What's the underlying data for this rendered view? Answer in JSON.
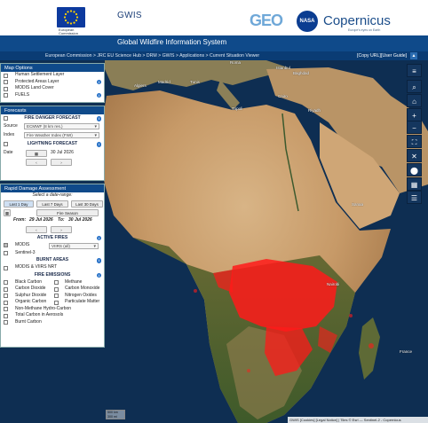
{
  "header": {
    "eu_org_line1": "European",
    "eu_org_line2": "Commission",
    "app_short": "GWIS",
    "geo_logo": "GEO",
    "nasa_logo": "NASA",
    "copernicus_logo": "Copernicus",
    "copernicus_tagline": "Europe's eyes on Earth",
    "site_title": "Global Wildfire Information System"
  },
  "breadcrumb": {
    "path": "European Commission > JRC EU Science Hub > DRM > GWIS > Applications > Current Situation Viewer",
    "copy_url": "[Copy URL]",
    "user_guide": "[User Guide]"
  },
  "map_options": {
    "title": "Map Options",
    "items": [
      {
        "label": "Human Settlement Layer",
        "info": false
      },
      {
        "label": "Protected Areas Layer",
        "info": true
      },
      {
        "label": "MODIS Land Cover",
        "info": false
      },
      {
        "label": "FUELS",
        "info": true
      }
    ]
  },
  "forecasts": {
    "title": "Forecasts",
    "fire_danger_title": "FIRE DANGER FORECAST",
    "source_label": "Source",
    "source_value": "ECMWF (8 km res.)",
    "index_label": "Index",
    "index_value": "Fire Weather Index (FWI)",
    "lightning_title": "LIGHTNING FORECAST",
    "date_label": "Date",
    "date_value": "30 Jul 2026",
    "prev_arrow": "‹",
    "next_arrow": "›"
  },
  "rapid_damage": {
    "title": "Rapid Damage Assessment",
    "select_range": "Select a date-range:",
    "btn_last1": "Last 1 Day",
    "btn_last7": "Last 7 Days",
    "btn_last30": "Last 30 Days",
    "btn_fire_season": "Fire Season",
    "from_label": "From:",
    "from_date": "29 Jul 2026",
    "to_label": "To:",
    "to_date": "30 Jul 2026",
    "prev_arrow": "‹",
    "next_arrow": "›",
    "active_fires_title": "ACTIVE FIRES",
    "modis_label": "MODIS",
    "viirs_value": "VIIRS (all)",
    "sentinel_label": "Sentinel-3",
    "burnt_areas_title": "BURNT AREAS",
    "burnt_label": "MODIS & VIIRS NRT",
    "fire_emissions_title": "FIRE EMISSIONS",
    "emissions_left": [
      "Black Carbon",
      "Carbon Dioxide",
      "Sulphur Dioxide",
      "Organic Carbon",
      "Non-Methane Hydro-Carbon",
      "Total Carbon in Aerosols",
      "Burnt Carbon"
    ],
    "emissions_right": [
      "Methane",
      "Carbon Monoxide",
      "Nitrogen Oxides",
      "Particulate Matter"
    ]
  },
  "toolbar": {
    "menu_icon": "menu-icon",
    "search_icon": "search-icon",
    "home_icon": "home-icon",
    "zoom_in": "+",
    "zoom_out": "−",
    "fullscreen_icon": "fullscreen-icon",
    "collapse_icon": "collapse-icon",
    "location_icon": "location-pin-icon",
    "layers_icon": "grid-icon",
    "list_icon": "list-icon"
  },
  "map": {
    "labels": [
      "Roma",
      "Madrid",
      "Istanbul",
      "Algiers",
      "Tunis",
      "Tripoli",
      "Cairo",
      "Riyadh",
      "Baghdad",
      "Sanaa",
      "Nairobi",
      "France"
    ],
    "scale_km": "500 km",
    "scale_mi": "300 mi",
    "attribution": "GWIS [Cookies] [Legal Notice] | Tiles © Esri — Sentinel-2 - Copernicus"
  },
  "colors": {
    "header_blue": "#0f4a8a",
    "crumb_blue": "#0a3c74",
    "toolbar_blue": "#14365e",
    "fire_red": "#ff1a1a"
  }
}
